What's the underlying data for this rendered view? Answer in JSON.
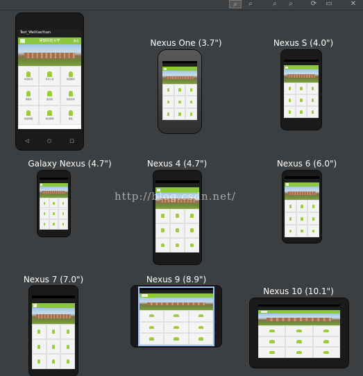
{
  "toolbar": {
    "buttons": [
      {
        "name": "zoom-fit-icon",
        "glyph": "⌕"
      },
      {
        "name": "zoom-out-icon",
        "glyph": "⌕"
      },
      {
        "name": "zoom-in-icon",
        "glyph": "⌕"
      },
      {
        "name": "zoom-actual-icon",
        "glyph": "⌕"
      },
      {
        "name": "refresh-icon",
        "glyph": "⟳"
      },
      {
        "name": "screenshot-icon",
        "glyph": "▭"
      },
      {
        "name": "close-preview-icon",
        "glyph": "✕"
      }
    ]
  },
  "app": {
    "title": "Test_WeiXiaoYuan",
    "header": "吴琪科技大学",
    "exit_label": "退出",
    "menu": [
      "校园新闻",
      "考试公告",
      "校园服务",
      "课程表",
      "图书馆",
      "我的资料",
      "校园地图",
      "校园视频",
      "更多"
    ]
  },
  "devices": [
    {
      "label": "",
      "title": "Test_WeiXiaoYuan"
    },
    {
      "label": "Nexus One (3.7\")"
    },
    {
      "label": "Nexus S (4.0\")"
    },
    {
      "label": "Galaxy Nexus (4.7\")"
    },
    {
      "label": "Nexus 4 (4.7\")"
    },
    {
      "label": "Nexus 6 (6.0\")"
    },
    {
      "label": "Nexus 7 (7.0\")"
    },
    {
      "label": "Nexus 9 (8.9\")"
    },
    {
      "label": "Nexus 10 (10.1\")"
    }
  ],
  "watermark": "http://blog.csdn.net/"
}
